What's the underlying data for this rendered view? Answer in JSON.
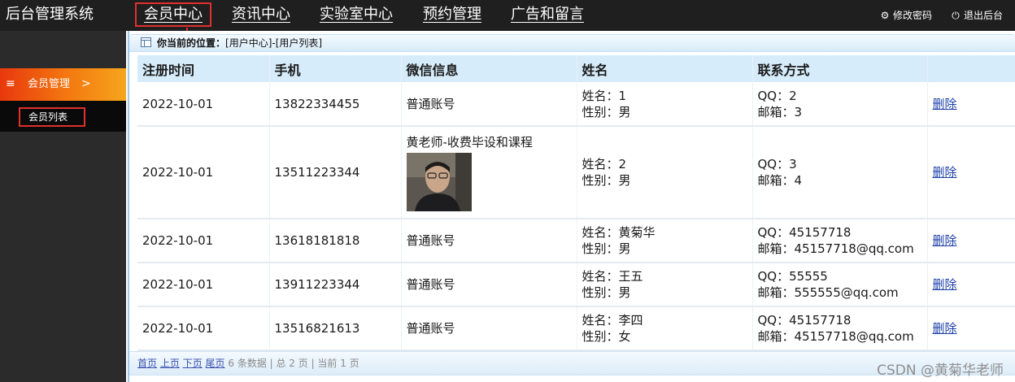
{
  "app": {
    "title": "后台管理系统"
  },
  "nav": {
    "items": [
      {
        "label": "会员中心"
      },
      {
        "label": "资讯中心"
      },
      {
        "label": "实验室中心"
      },
      {
        "label": "预约管理"
      },
      {
        "label": "广告和留言"
      }
    ],
    "change_password": "修改密码",
    "logout": "退出后台"
  },
  "sidebar": {
    "group": {
      "label": "会员管理",
      "chevron": ">"
    },
    "sub_item": "会员列表"
  },
  "breadcrumb": {
    "prefix": "你当前的位置：",
    "path": "[用户中心]-[用户列表]"
  },
  "table": {
    "headers": [
      "注册时间",
      "手机",
      "微信信息",
      "姓名",
      "联系方式",
      ""
    ],
    "rows": [
      {
        "date": "2022-10-01",
        "phone": "13822334455",
        "wechat": "普通账号",
        "name": "姓名：1",
        "gender": "性别：男",
        "qq": "QQ：2",
        "email": "邮箱：3",
        "action": "删除"
      },
      {
        "date": "2022-10-01",
        "phone": "13511223344",
        "wechat": "黄老师-收费毕设和课程",
        "name": "姓名：2",
        "gender": "性别：男",
        "qq": "QQ：3",
        "email": "邮箱：4",
        "action": "删除"
      },
      {
        "date": "2022-10-01",
        "phone": "13618181818",
        "wechat": "普通账号",
        "name": "姓名：黄菊华",
        "gender": "性别：男",
        "qq": "QQ：45157718",
        "email": "邮箱：45157718@qq.com",
        "action": "删除"
      },
      {
        "date": "2022-10-01",
        "phone": "13911223344",
        "wechat": "普通账号",
        "name": "姓名：王五",
        "gender": "性别：男",
        "qq": "QQ：55555",
        "email": "邮箱：555555@qq.com",
        "action": "删除"
      },
      {
        "date": "2022-10-01",
        "phone": "13516821613",
        "wechat": "普通账号",
        "name": "姓名：李四",
        "gender": "性别：女",
        "qq": "QQ：45157718",
        "email": "邮箱：45157718@qq.com",
        "action": "删除"
      }
    ]
  },
  "pager": {
    "first": "首页",
    "prev": "上页",
    "next": "下页",
    "last": "尾页",
    "summary": "6 条数据 | 总 2 页 | 当前 1 页"
  },
  "watermark": "CSDN @黄菊华老师",
  "colors": {
    "topbar": "#1f1f1f",
    "sidebar": "#2b2b2b",
    "sidebar_active_start": "#e8380d",
    "sidebar_active_end": "#f6a51d",
    "header_row": "#d6ecfa",
    "highlight_box": "#e03030",
    "link": "#1c3fa8"
  },
  "icons": {
    "change_password": "gear-icon",
    "logout": "power-icon",
    "menu": "hamburger-icon",
    "breadcrumb": "table-icon"
  }
}
